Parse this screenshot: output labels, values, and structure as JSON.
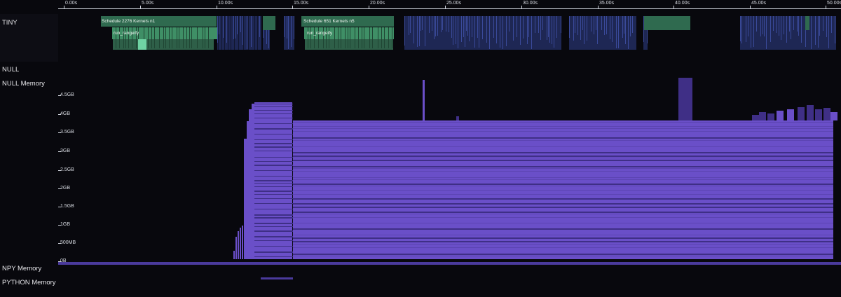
{
  "tracks": {
    "tiny": "TINY",
    "null": "NULL",
    "null_memory": "NULL Memory",
    "npy_memory": "NPY Memory",
    "python_memory": "PYTHON Memory"
  },
  "ruler": {
    "ticks": [
      "0.00s",
      "5.00s",
      "10.00s",
      "15.00s",
      "20.00s",
      "25.00s",
      "30.00s",
      "35.00s",
      "40.00s",
      "45.00s",
      "50.00s"
    ]
  },
  "events": {
    "schedule_1": "Schedule 2276 Kernels n1",
    "rangeify_1": "run_rangeify",
    "schedule_2": "Schedule 651 Kernels n5",
    "rangeify_2": "run_rangeify"
  },
  "memory_axis": {
    "labels": [
      "4.5GB",
      "4GB",
      "3.5GB",
      "3GB",
      "2.5GB",
      "2GB",
      "1.5GB",
      "1GB",
      "500MB",
      "0B"
    ]
  },
  "colors": {
    "background": "#08080d",
    "schedule_green": "#2f6a4f",
    "rangeify_green": "#3f8f66",
    "kernel_blue": "#3a4a9a",
    "memory_purple": "#6a4fc8",
    "memory_dark": "#3f2f86"
  }
}
